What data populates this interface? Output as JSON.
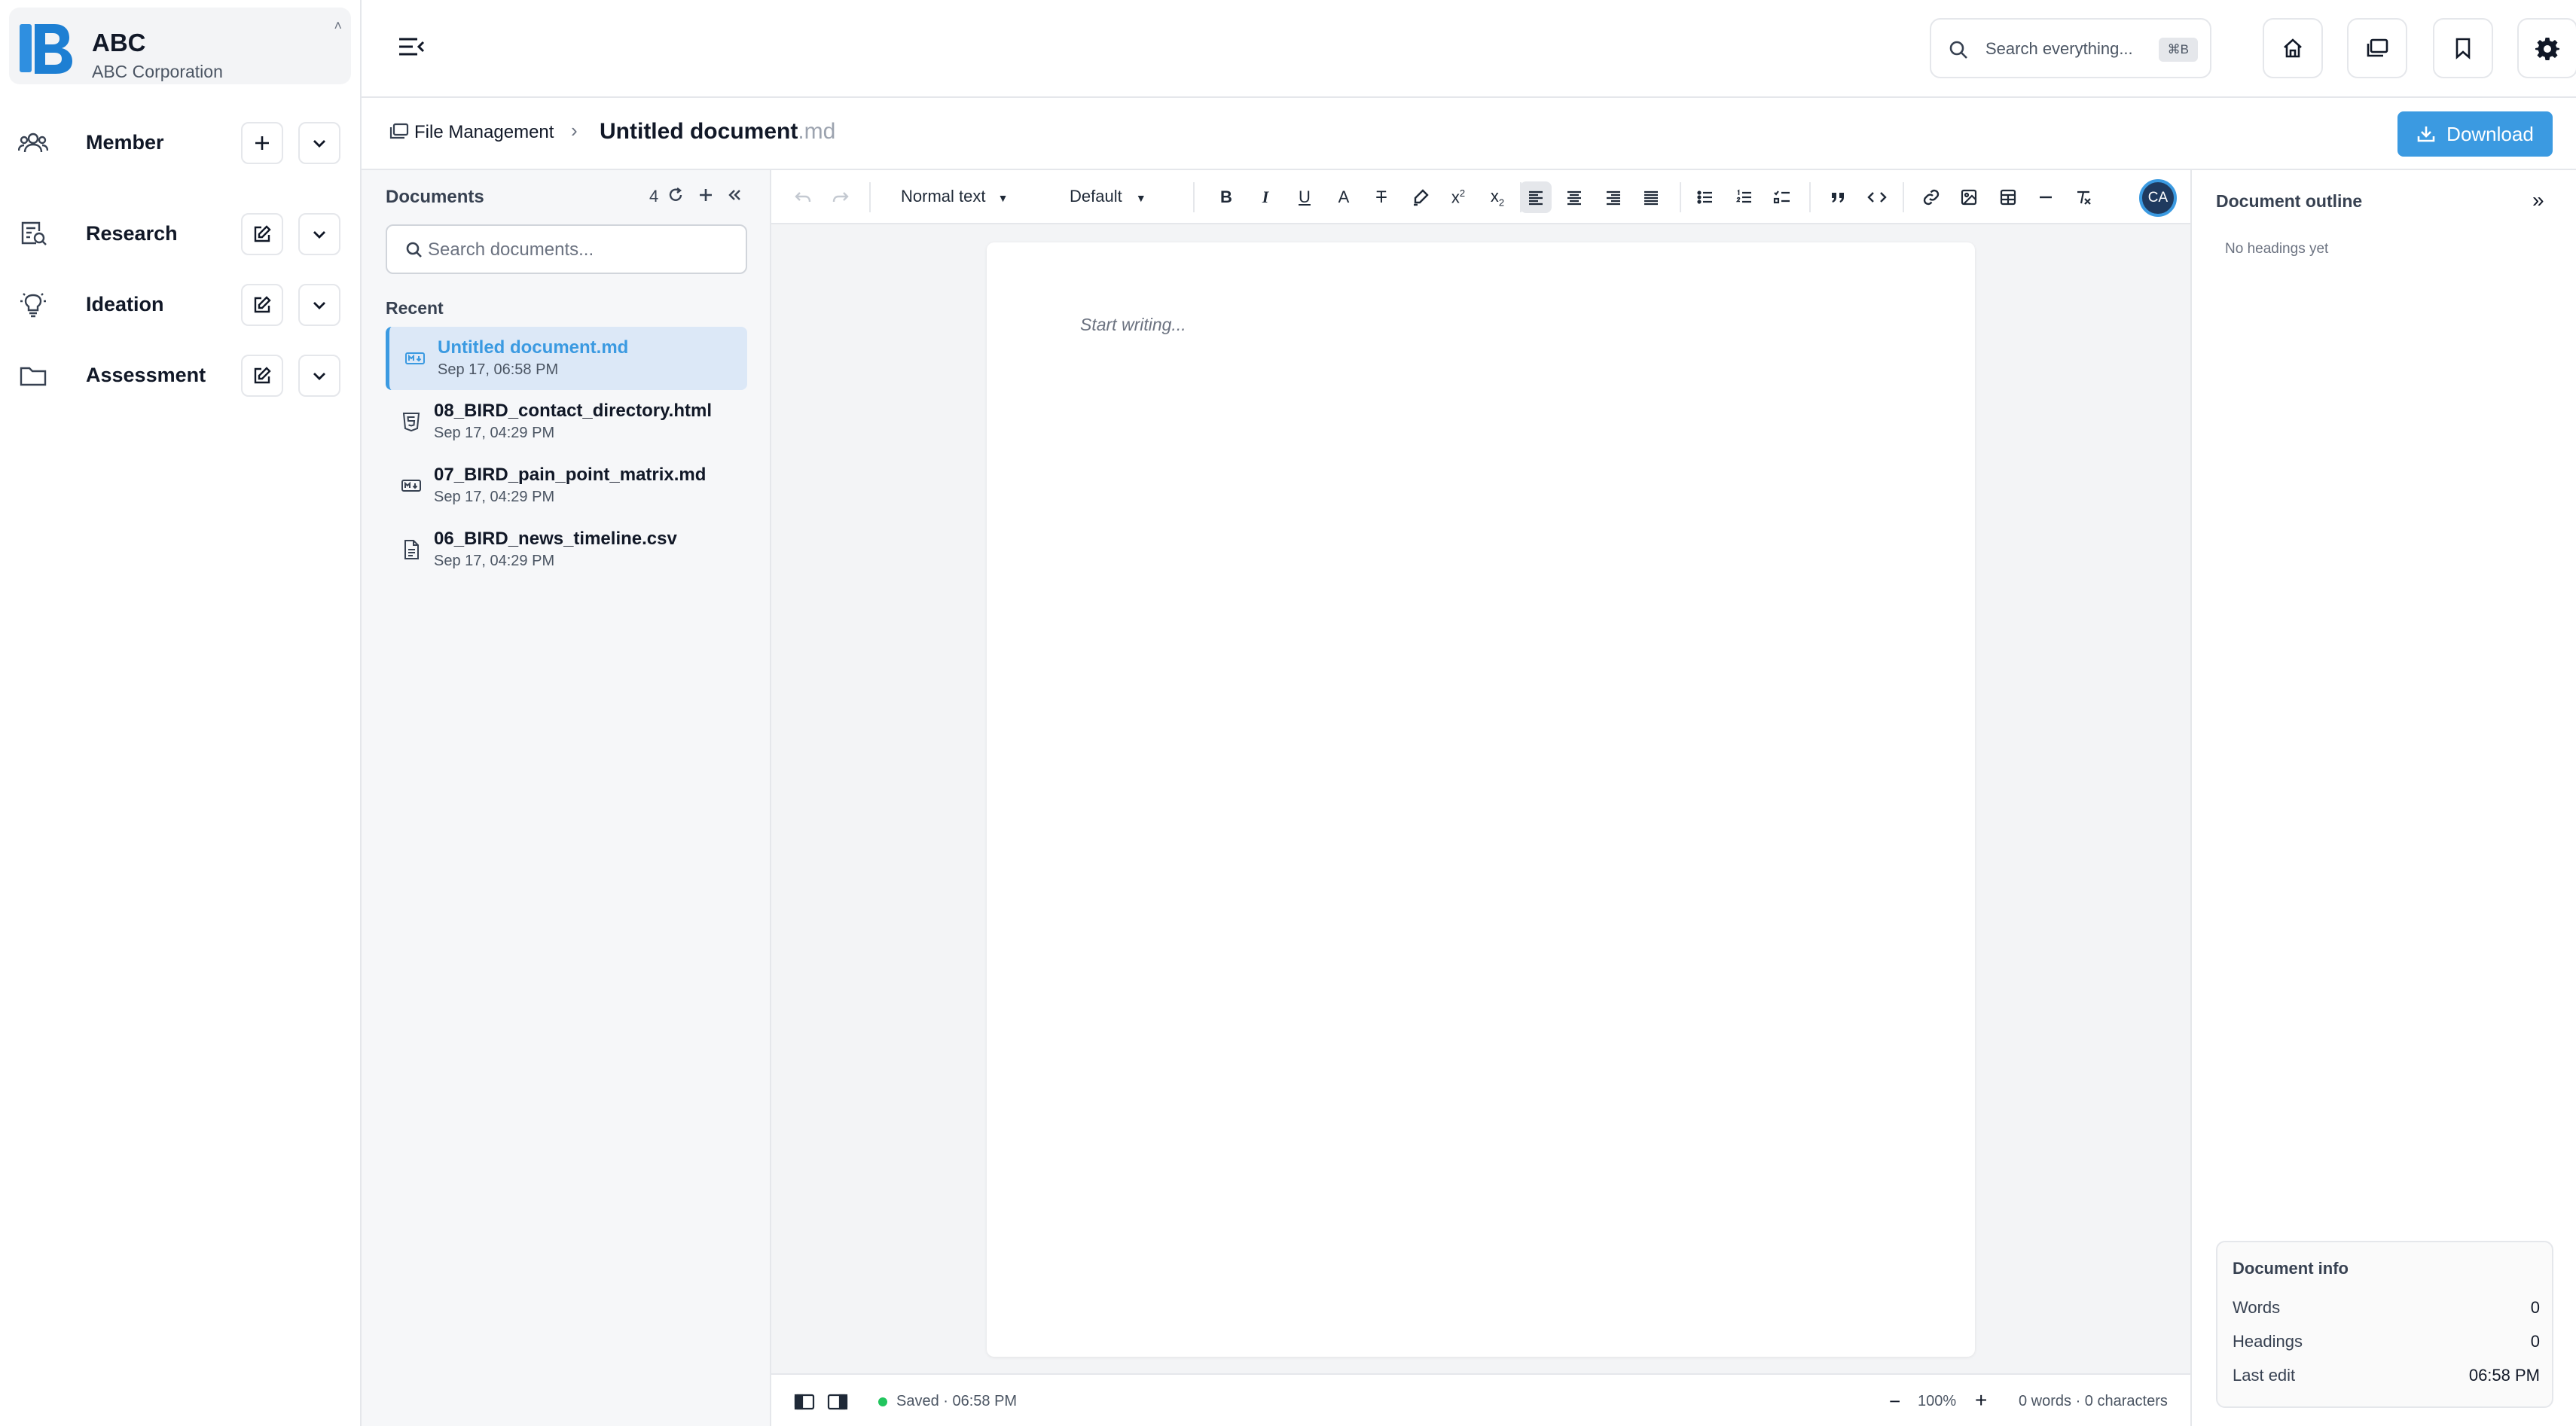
{
  "org": {
    "name": "ABC",
    "subtitle": "ABC Corporation",
    "caret": "˄"
  },
  "nav": {
    "items": [
      {
        "label": "Member"
      },
      {
        "label": "Research"
      },
      {
        "label": "Ideation"
      },
      {
        "label": "Assessment"
      }
    ]
  },
  "header": {
    "search_placeholder": "Search everything...",
    "search_shortcut": "⌘B"
  },
  "breadcrumb": {
    "root": "File Management",
    "separator": "›",
    "title": "Untitled document",
    "extension": ".md"
  },
  "download_label": "Download",
  "documents": {
    "title": "Documents",
    "count": "4",
    "search_placeholder": "Search documents...",
    "recent_label": "Recent",
    "items": [
      {
        "name": "Untitled document.md",
        "date": "Sep 17, 06:58 PM",
        "icon": "markdown-icon",
        "active": true
      },
      {
        "name": "08_BIRD_contact_directory.html",
        "date": "Sep 17, 04:29 PM",
        "icon": "html5-icon",
        "active": false
      },
      {
        "name": "07_BIRD_pain_point_matrix.md",
        "date": "Sep 17, 04:29 PM",
        "icon": "markdown-icon",
        "active": false
      },
      {
        "name": "06_BIRD_news_timeline.csv",
        "date": "Sep 17, 04:29 PM",
        "icon": "file-text-icon",
        "active": false
      }
    ]
  },
  "toolbar": {
    "text_style": "Normal text",
    "font": "Default",
    "avatar_initials": "CA"
  },
  "editor": {
    "placeholder": "Start writing..."
  },
  "status": {
    "saved": "Saved · 06:58 PM",
    "zoom": "100%",
    "counts": "0 words · 0 characters"
  },
  "outline": {
    "title": "Document outline",
    "empty": "No headings yet",
    "collapse_glyph": "»"
  },
  "doc_info": {
    "title": "Document info",
    "words_label": "Words",
    "words": "0",
    "headings_label": "Headings",
    "headings": "0",
    "last_edit_label": "Last edit",
    "last_edit": "06:58 PM"
  },
  "colors": {
    "accent": "#3b9ae1",
    "saved_dot": "#22c55e",
    "active_bg": "#dce8f7"
  }
}
